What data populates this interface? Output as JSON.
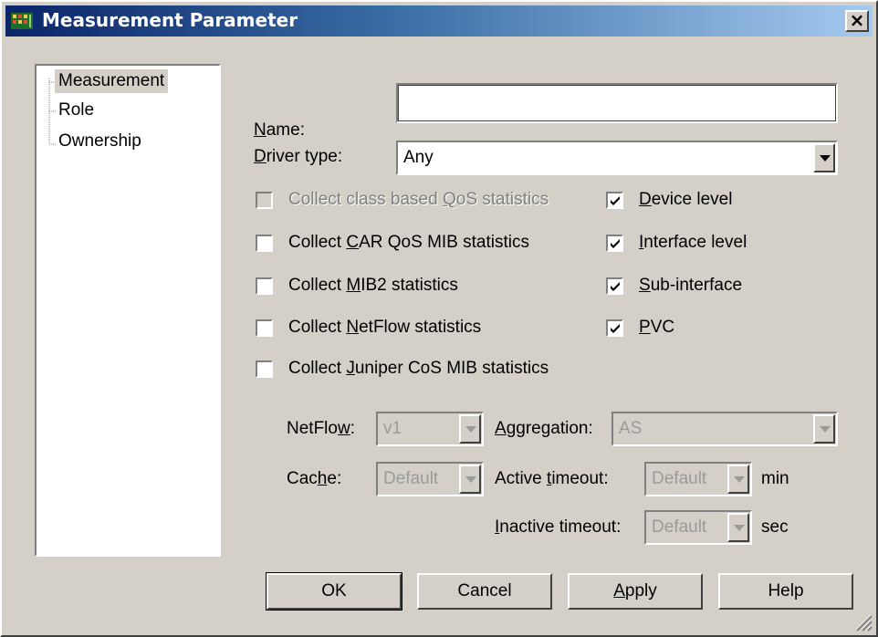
{
  "window": {
    "title": "Measurement Parameter",
    "close_label": "×"
  },
  "tree": {
    "items": [
      {
        "label": "Measurement"
      },
      {
        "label": "Role"
      },
      {
        "label": "Ownership"
      }
    ]
  },
  "form": {
    "name": {
      "label_key": "N",
      "label_rest": "ame:",
      "value": ""
    },
    "driver_type": {
      "label_key": "D",
      "label_rest": "river type:",
      "value": "Any"
    },
    "checks_left": [
      {
        "pre": "Collect class based ",
        "key": "Q",
        "post": "oS statistics",
        "checked": false,
        "disabled": true
      },
      {
        "pre": "Collect ",
        "key": "C",
        "post": "AR QoS MIB statistics",
        "checked": false,
        "disabled": false
      },
      {
        "pre": "Collect ",
        "key": "M",
        "post": "IB2 statistics",
        "checked": false,
        "disabled": false
      },
      {
        "pre": "Collect ",
        "key": "N",
        "post": "etFlow statistics",
        "checked": false,
        "disabled": false
      },
      {
        "pre": "Collect ",
        "key": "J",
        "post": "uniper CoS MIB statistics",
        "checked": false,
        "disabled": false
      }
    ],
    "checks_right": [
      {
        "pre": "",
        "key": "D",
        "post": "evice level",
        "checked": true
      },
      {
        "pre": "",
        "key": "I",
        "post": "nterface level",
        "checked": true
      },
      {
        "pre": "",
        "key": "S",
        "post": "ub-interface",
        "checked": true
      },
      {
        "pre": "",
        "key": "P",
        "post": "VC",
        "checked": true
      }
    ],
    "netflow": {
      "pre": "NetFlo",
      "key": "w",
      "post": ":",
      "value": "v1"
    },
    "aggregation": {
      "pre": "",
      "key": "A",
      "post": "ggregation:",
      "value": "AS"
    },
    "cache": {
      "pre": "Cac",
      "key": "h",
      "post": "e:",
      "value": "Default"
    },
    "active_timeout": {
      "pre": "Active ",
      "key": "t",
      "post": "imeout:",
      "value": "Default",
      "unit": "min"
    },
    "inactive_timeout": {
      "pre": "",
      "key": "I",
      "post": "nactive timeout:",
      "value": "Default",
      "unit": "sec"
    }
  },
  "buttons": {
    "ok": "OK",
    "cancel": "Cancel",
    "apply_key": "A",
    "apply_rest": "pply",
    "help": "Help"
  }
}
